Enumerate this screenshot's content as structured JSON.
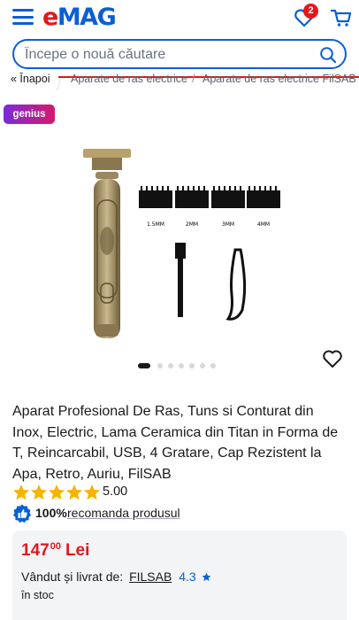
{
  "header": {
    "logo": "eMAG",
    "favorites_count": "2"
  },
  "search": {
    "placeholder": "Începe o nouă căutare"
  },
  "breadcrumb": {
    "back_label": "« Înapoi",
    "items": [
      "Aparate de ras electrice",
      "Aparate de ras electrice FilSAB"
    ],
    "separator": "/"
  },
  "badges": {
    "genius": "genius"
  },
  "gallery": {
    "total_images": 7,
    "active_index": 0,
    "comb_labels": [
      "1.5MM",
      "2MM",
      "3MM",
      "4MM"
    ]
  },
  "product": {
    "title": "Aparat Profesional De Ras, Tuns si Conturat din Inox, Electric, Lama Ceramica din Titan in Forma de T, Reincarcabil, USB, 4 Gratare, Cap Rezistent la Apa, Retro, Auriu, FilSAB",
    "rating": "5.00",
    "stars": 5,
    "recommend_pct": "100%",
    "recommend_text": "recomanda produsul"
  },
  "offer": {
    "price_int": "147",
    "price_dec": "00",
    "currency": "Lei",
    "sold_by_label": "Vândut și livrat de:",
    "seller_name": "FILSAB",
    "seller_rating": "4.3",
    "stock": "în stoc"
  },
  "colors": {
    "brand_blue": "#0b5fd3",
    "brand_red": "#e3171b",
    "star_gold": "#f5b400"
  }
}
